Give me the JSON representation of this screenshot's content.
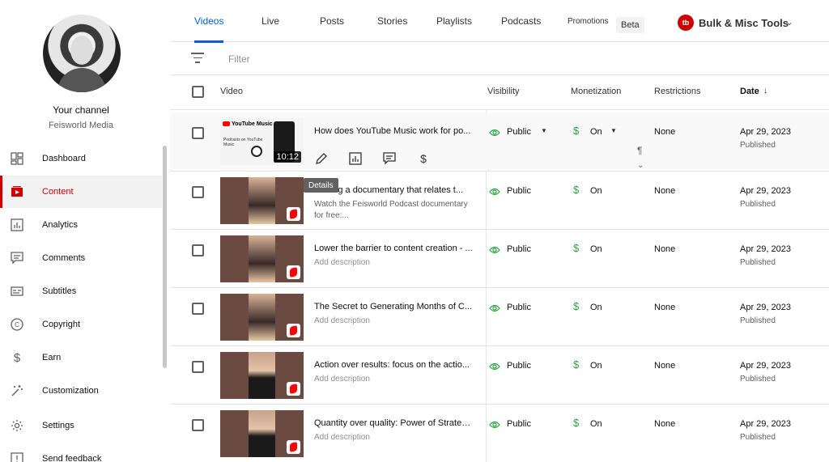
{
  "channel": {
    "title": "Your channel",
    "name": "Feisworld Media"
  },
  "sidebar": {
    "items": [
      {
        "label": "Dashboard",
        "icon": "dashboard-icon"
      },
      {
        "label": "Content",
        "icon": "content-icon",
        "active": true
      },
      {
        "label": "Analytics",
        "icon": "analytics-icon"
      },
      {
        "label": "Comments",
        "icon": "comments-icon"
      },
      {
        "label": "Subtitles",
        "icon": "subtitles-icon"
      },
      {
        "label": "Copyright",
        "icon": "copyright-icon"
      },
      {
        "label": "Earn",
        "icon": "earn-icon"
      },
      {
        "label": "Customization",
        "icon": "customization-icon"
      },
      {
        "label": "Settings",
        "icon": "settings-icon"
      },
      {
        "label": "Send feedback",
        "icon": "feedback-icon"
      }
    ]
  },
  "tabs": [
    {
      "label": "Videos",
      "active": true
    },
    {
      "label": "Live"
    },
    {
      "label": "Posts"
    },
    {
      "label": "Stories"
    },
    {
      "label": "Playlists"
    },
    {
      "label": "Podcasts"
    },
    {
      "label": "Promotions"
    }
  ],
  "beta_label": "Beta",
  "tool": {
    "logo": "tb",
    "label": "Bulk & Misc Tools"
  },
  "filter": {
    "placeholder": "Filter"
  },
  "columns": {
    "video": "Video",
    "visibility": "Visibility",
    "monetization": "Monetization",
    "restrictions": "Restrictions",
    "date": "Date"
  },
  "tooltip": "Details",
  "rows": [
    {
      "title": "How does YouTube Music work for po...",
      "description": "",
      "duration": "10:12",
      "visibility": "Public",
      "monetization": "On",
      "restrictions": "None",
      "date": "Apr 29, 2023",
      "status": "Published",
      "thumb": "youtube-music",
      "thumb_logo": "YouTube Music",
      "thumb_caption": "Podcasts on YouTube Music"
    },
    {
      "title": "Making a documentary that relates t...",
      "description": "Watch the Feisworld Podcast documentary for free:...",
      "visibility": "Public",
      "monetization": "On",
      "restrictions": "None",
      "date": "Apr 29, 2023",
      "status": "Published",
      "thumb": "short"
    },
    {
      "title": "Lower the barrier to content creation - ...",
      "description": "Add description",
      "visibility": "Public",
      "monetization": "On",
      "restrictions": "None",
      "date": "Apr 29, 2023",
      "status": "Published",
      "thumb": "short"
    },
    {
      "title": "The Secret to Generating Months of C...",
      "description": "Add description",
      "visibility": "Public",
      "monetization": "On",
      "restrictions": "None",
      "date": "Apr 29, 2023",
      "status": "Published",
      "thumb": "short"
    },
    {
      "title": "Action over results: focus on the actio...",
      "description": "Add description",
      "visibility": "Public",
      "monetization": "On",
      "restrictions": "None",
      "date": "Apr 29, 2023",
      "status": "Published",
      "thumb": "short-man"
    },
    {
      "title": "Quantity over quality: Power of Strateg...",
      "description": "Add description",
      "visibility": "Public",
      "monetization": "On",
      "restrictions": "None",
      "date": "Apr 29, 2023",
      "status": "Published",
      "thumb": "short-man"
    }
  ],
  "colors": {
    "accent": "#065fd4",
    "active_nav": "#cc0000",
    "monetization": "#2ba640"
  }
}
